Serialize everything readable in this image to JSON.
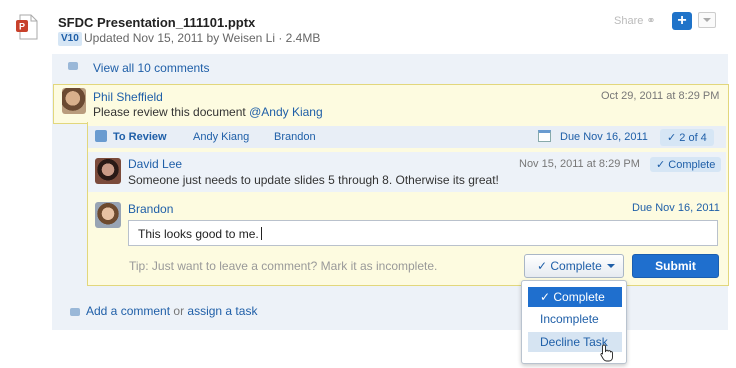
{
  "file": {
    "title": "SFDC Presentation_111101.pptx",
    "version": "V10",
    "meta": "Updated Nov 15, 2011 by Weisen Li · 2.4MB",
    "share_label": "Share",
    "icon": "powerpoint-file-icon"
  },
  "comments_link": "View all 10 comments",
  "comment": {
    "author": "Phil Sheffield",
    "timestamp": "Oct 29, 2011 at 8:29 PM",
    "text": "Please review this document ",
    "mention": "@Andy Kiang"
  },
  "task": {
    "status_label": "To Review",
    "assignees": [
      "Andy Kiang",
      "Brandon"
    ],
    "due": "Due Nov 16, 2011",
    "progress": "2 of 4"
  },
  "david": {
    "author": "David Lee",
    "timestamp": "Nov 15, 2011 at 8:29 PM",
    "status": "Complete",
    "text": "Someone just needs to update slides 5 through 8. Otherwise its great!"
  },
  "brandon": {
    "author": "Brandon",
    "due": "Due Nov 16, 2011",
    "reply_value": "This looks good to me.",
    "tip": "Tip: Just want to leave a comment? Mark it as incomplete.",
    "complete_label": "Complete",
    "submit_label": "Submit"
  },
  "dropdown": {
    "options": [
      "Complete",
      "Incomplete",
      "Decline Task"
    ],
    "selected": "Complete",
    "hovered": "Decline Task"
  },
  "footer": {
    "add_comment": "Add a comment",
    "or_text": "or",
    "assign_task": "assign a task"
  },
  "colors": {
    "accent": "#1f6fce",
    "link": "#1f5fa8",
    "highlight": "#fdfbe0"
  }
}
